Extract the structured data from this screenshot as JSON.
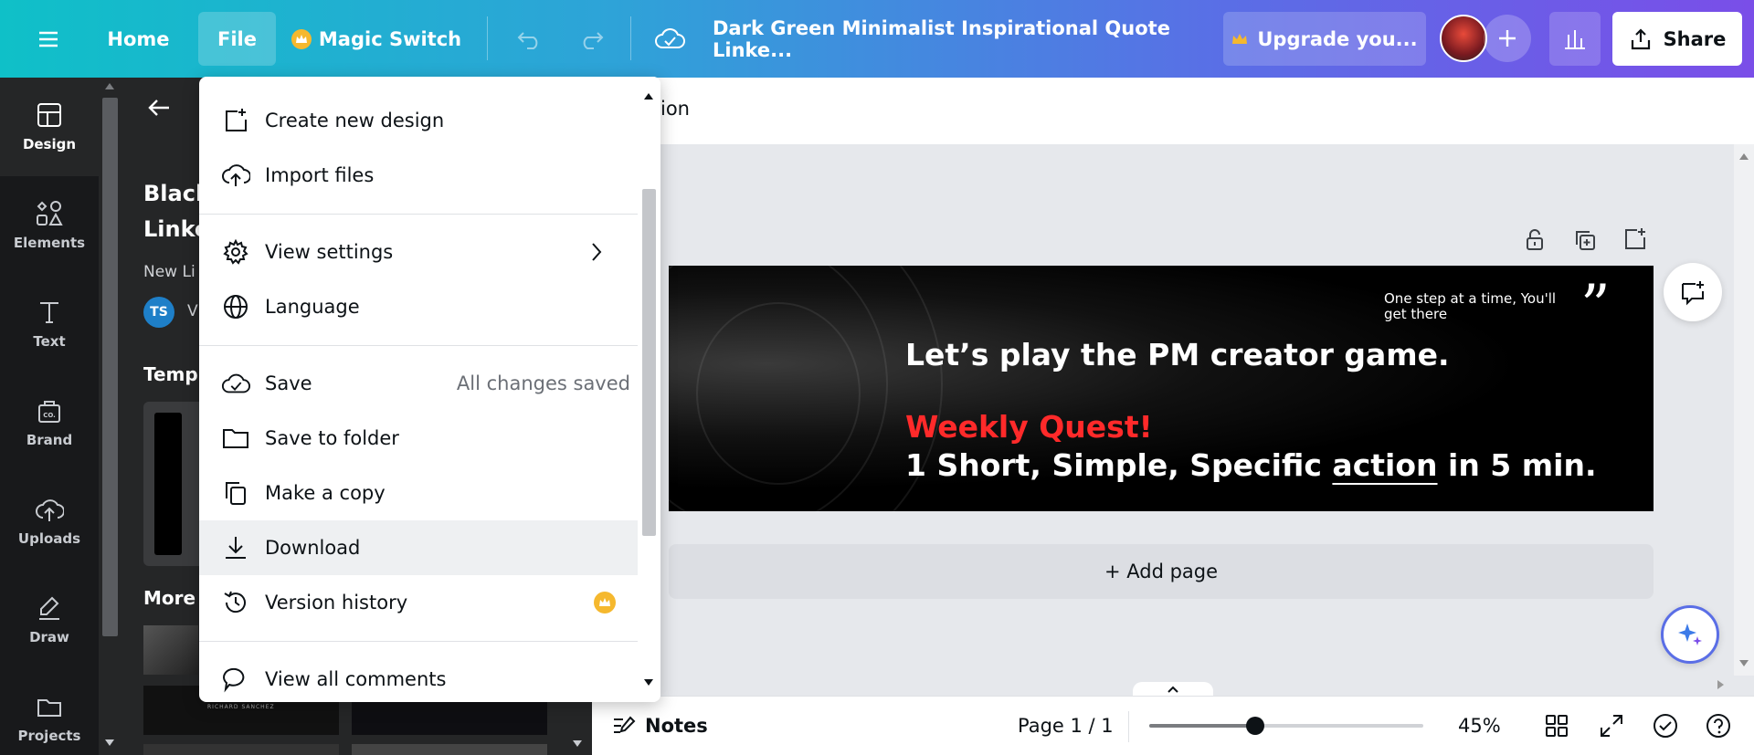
{
  "topbar": {
    "home": "Home",
    "file": "File",
    "magic_switch": "Magic Switch",
    "doc_title": "Dark Green Minimalist Inspirational Quote Linke...",
    "upgrade": "Upgrade you...",
    "share": "Share"
  },
  "rail": {
    "items": [
      {
        "label": "Design",
        "icon": "layout-icon"
      },
      {
        "label": "Elements",
        "icon": "elements-icon"
      },
      {
        "label": "Text",
        "icon": "text-icon"
      },
      {
        "label": "Brand",
        "icon": "brand-icon"
      },
      {
        "label": "Uploads",
        "icon": "upload-icon"
      },
      {
        "label": "Draw",
        "icon": "draw-icon"
      },
      {
        "label": "Projects",
        "icon": "folder-icon"
      }
    ]
  },
  "panel": {
    "title_line1": "Black",
    "title_line2": "Linke",
    "subtitle": "New Li",
    "avatar_initials": "TS",
    "avatar_suffix": "V",
    "templates_heading": "Templ",
    "more_heading": "More",
    "thumb_caption": "RICHARD SANCHEZ"
  },
  "context_bar": {
    "partial_label": "ion"
  },
  "design": {
    "quote_small": "One step at a time, You'll get there",
    "quote_mark": "”",
    "line1": "Let’s play the PM creator game.",
    "line2": "Weekly Quest!",
    "line3_prefix": "1 Short, Simple, Specific ",
    "line3_action": "action",
    "line3_suffix": " in 5 min.",
    "accent_red": "#ff2a2a",
    "text_white": "#ffffff"
  },
  "add_page": "+ Add page",
  "bottom": {
    "notes": "Notes",
    "page": "Page 1 / 1",
    "zoom": "45%",
    "zoom_level": 0.385
  },
  "file_menu": {
    "items": [
      {
        "label": "Create new design",
        "icon": "create-design-icon"
      },
      {
        "label": "Import files",
        "icon": "cloud-upload-icon"
      },
      {
        "label": "View settings",
        "icon": "gear-icon"
      },
      {
        "label": "Language",
        "icon": "globe-icon"
      },
      {
        "label": "Save",
        "icon": "cloud-check-icon",
        "status": "All changes saved"
      },
      {
        "label": "Save to folder",
        "icon": "folder-icon"
      },
      {
        "label": "Make a copy",
        "icon": "copy-icon"
      },
      {
        "label": "Download",
        "icon": "download-icon"
      },
      {
        "label": "Version history",
        "icon": "history-icon"
      },
      {
        "label": "View all comments",
        "icon": "comment-icon"
      }
    ]
  },
  "colors": {
    "premium_gold": "#f5b82e",
    "topbar_start": "#0fc0c8",
    "topbar_end": "#7a4ee8"
  }
}
